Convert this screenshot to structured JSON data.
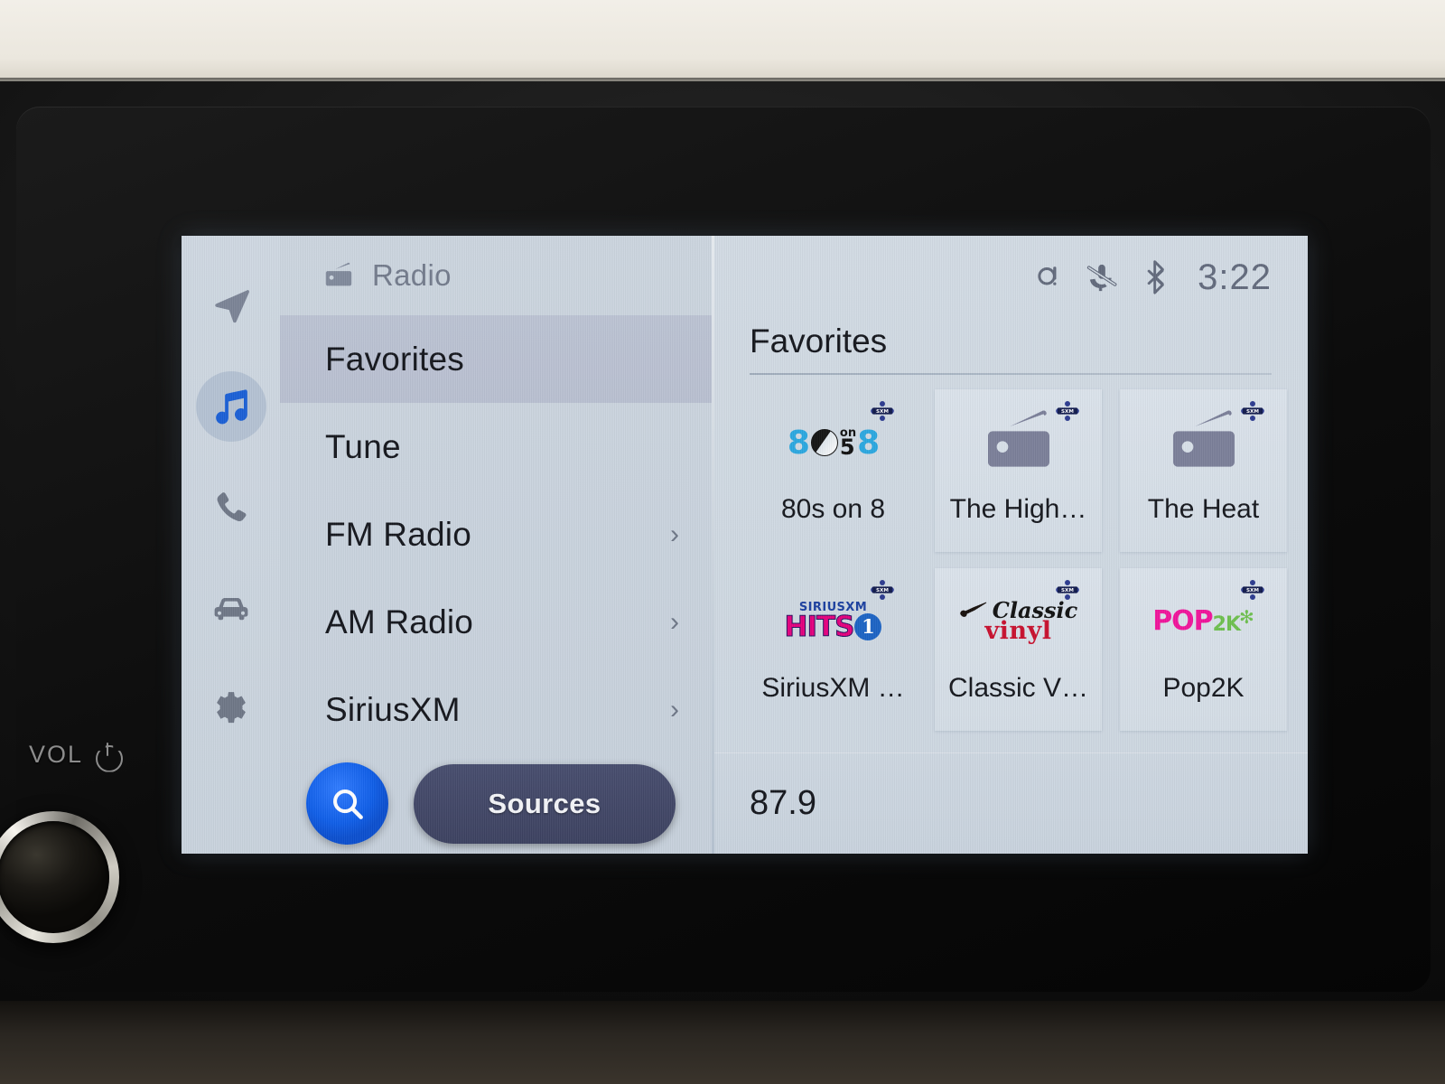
{
  "device": {
    "vol_label": "VOL",
    "power_icon": "power-icon",
    "knob_name": "volume-knob"
  },
  "rail": {
    "items": [
      {
        "icon": "navigation-arrow-icon",
        "name": "navigation",
        "active": false
      },
      {
        "icon": "music-note-icon",
        "name": "audio",
        "active": true
      },
      {
        "icon": "phone-icon",
        "name": "phone",
        "active": false
      },
      {
        "icon": "car-icon",
        "name": "vehicle",
        "active": false
      },
      {
        "icon": "gear-icon",
        "name": "settings",
        "active": false
      }
    ]
  },
  "list_panel": {
    "header_icon": "radio-icon",
    "header_title": "Radio",
    "menu": [
      {
        "label": "Favorites",
        "selected": true,
        "chevron": ""
      },
      {
        "label": "Tune",
        "selected": false,
        "chevron": ""
      },
      {
        "label": "FM Radio",
        "selected": false,
        "chevron": "›"
      },
      {
        "label": "AM Radio",
        "selected": false,
        "chevron": "›"
      },
      {
        "label": "SiriusXM",
        "selected": false,
        "chevron": "›"
      }
    ],
    "search_icon": "search-icon",
    "sources_label": "Sources"
  },
  "status_bar": {
    "icons": [
      "qi-wireless-charging-icon",
      "microphone-muted-icon",
      "bluetooth-icon"
    ],
    "clock": "3:22"
  },
  "content": {
    "title": "Favorites",
    "favorites": [
      {
        "label": "80s on 8",
        "logo": "80s-on-8-logo",
        "badge": "sxm-badge",
        "raised": false
      },
      {
        "label": "The High…",
        "logo": "generic-radio-icon",
        "badge": "sxm-badge",
        "raised": true
      },
      {
        "label": "The Heat",
        "logo": "generic-radio-icon",
        "badge": "sxm-badge",
        "raised": true
      },
      {
        "label": "SiriusXM …",
        "logo": "siriusxm-hits-1-logo",
        "badge": "sxm-badge",
        "raised": false
      },
      {
        "label": "Classic V…",
        "logo": "classic-vinyl-logo",
        "badge": "sxm-badge",
        "raised": true
      },
      {
        "label": "Pop2K",
        "logo": "pop2k-logo",
        "badge": "sxm-badge",
        "raised": true
      }
    ],
    "logo_text": {
      "eighties_left": "8",
      "eighties_on": "on",
      "eighties_s": "5",
      "eighties_right": "8",
      "hits_sx": "SIRIUSXM",
      "hits_word": "HITS",
      "hits_num": "1",
      "vinyl_classic": "Classic",
      "vinyl_word": "vinyl",
      "pop_word": "POP",
      "pop_2k": "2K",
      "pop_star": "✻",
      "sxm_badge_text": "SXM"
    },
    "frequency": "87.9"
  },
  "colors": {
    "screen_bg": "#ccd6e0",
    "accent_blue": "#0f5ee8",
    "sources_navy": "#474d6e",
    "music_active": "#1a5fd6",
    "icon_gray": "#7b8496",
    "text_dark": "#14161c"
  }
}
